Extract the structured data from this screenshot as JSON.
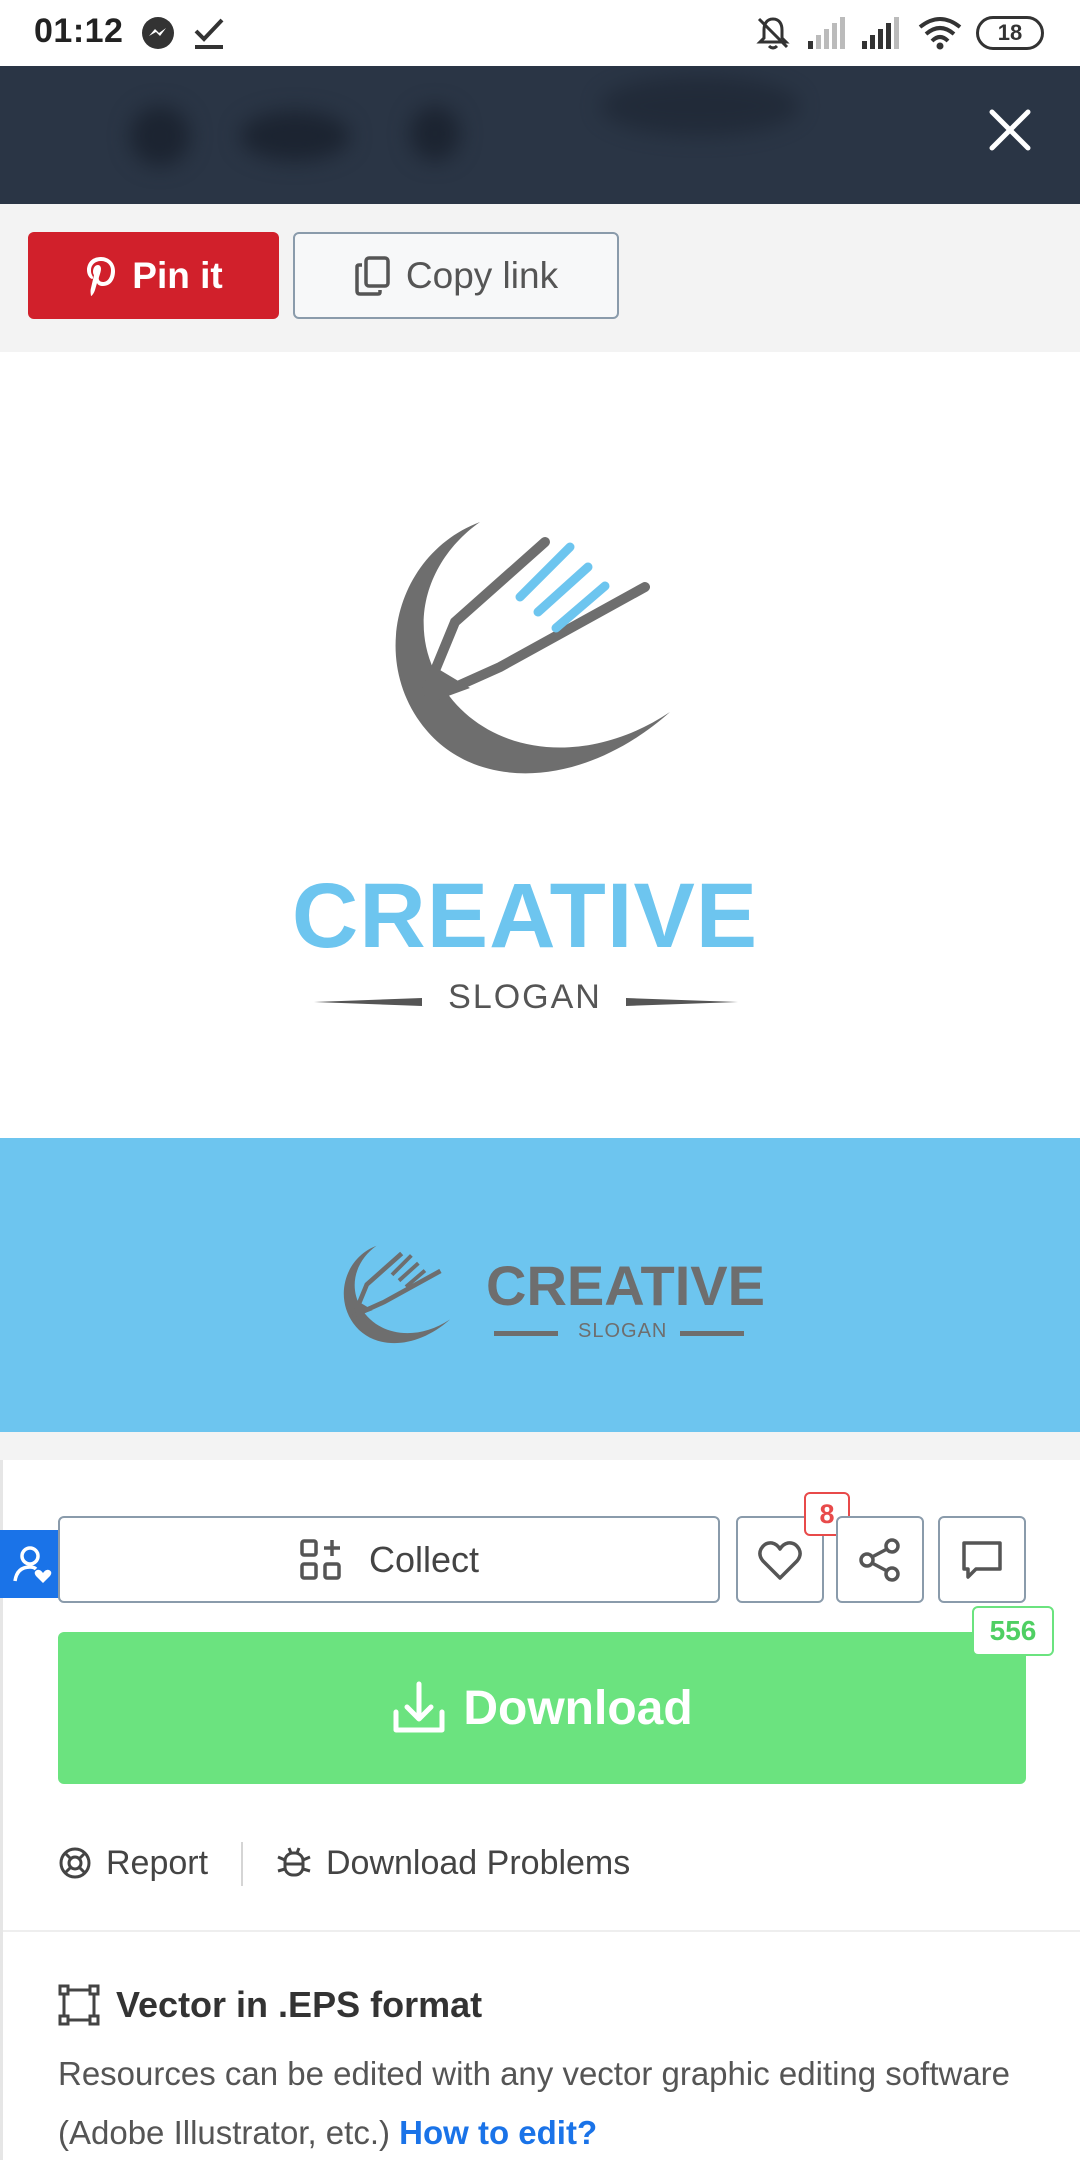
{
  "status_bar": {
    "time": "01:12",
    "battery": "18",
    "icons": [
      "messenger-icon",
      "check-icon",
      "mute-icon",
      "signal-icon",
      "signal-icon",
      "wifi-icon",
      "battery-icon"
    ]
  },
  "share": {
    "pin_label": "Pin it",
    "copy_label": "Copy link"
  },
  "preview": {
    "logo_title": "CREATIVE",
    "logo_slogan": "SLOGAN",
    "logo_color": "#6dc5ef",
    "blue_bg": "#6dc5ef"
  },
  "actions": {
    "collect_label": "Collect",
    "like_count": "8",
    "download_label": "Download",
    "download_count": "556",
    "report_label": "Report",
    "problems_label": "Download Problems"
  },
  "format": {
    "title": "Vector in .EPS format",
    "description": "Resources can be edited with any vector graphic editing software (Adobe Illustrator, etc.)",
    "link_label": "How to edit?"
  },
  "colors": {
    "pin_red": "#d1202b",
    "download_green": "#6be37f",
    "link_blue": "#1a73e8",
    "banner_dark": "#2a3545"
  }
}
